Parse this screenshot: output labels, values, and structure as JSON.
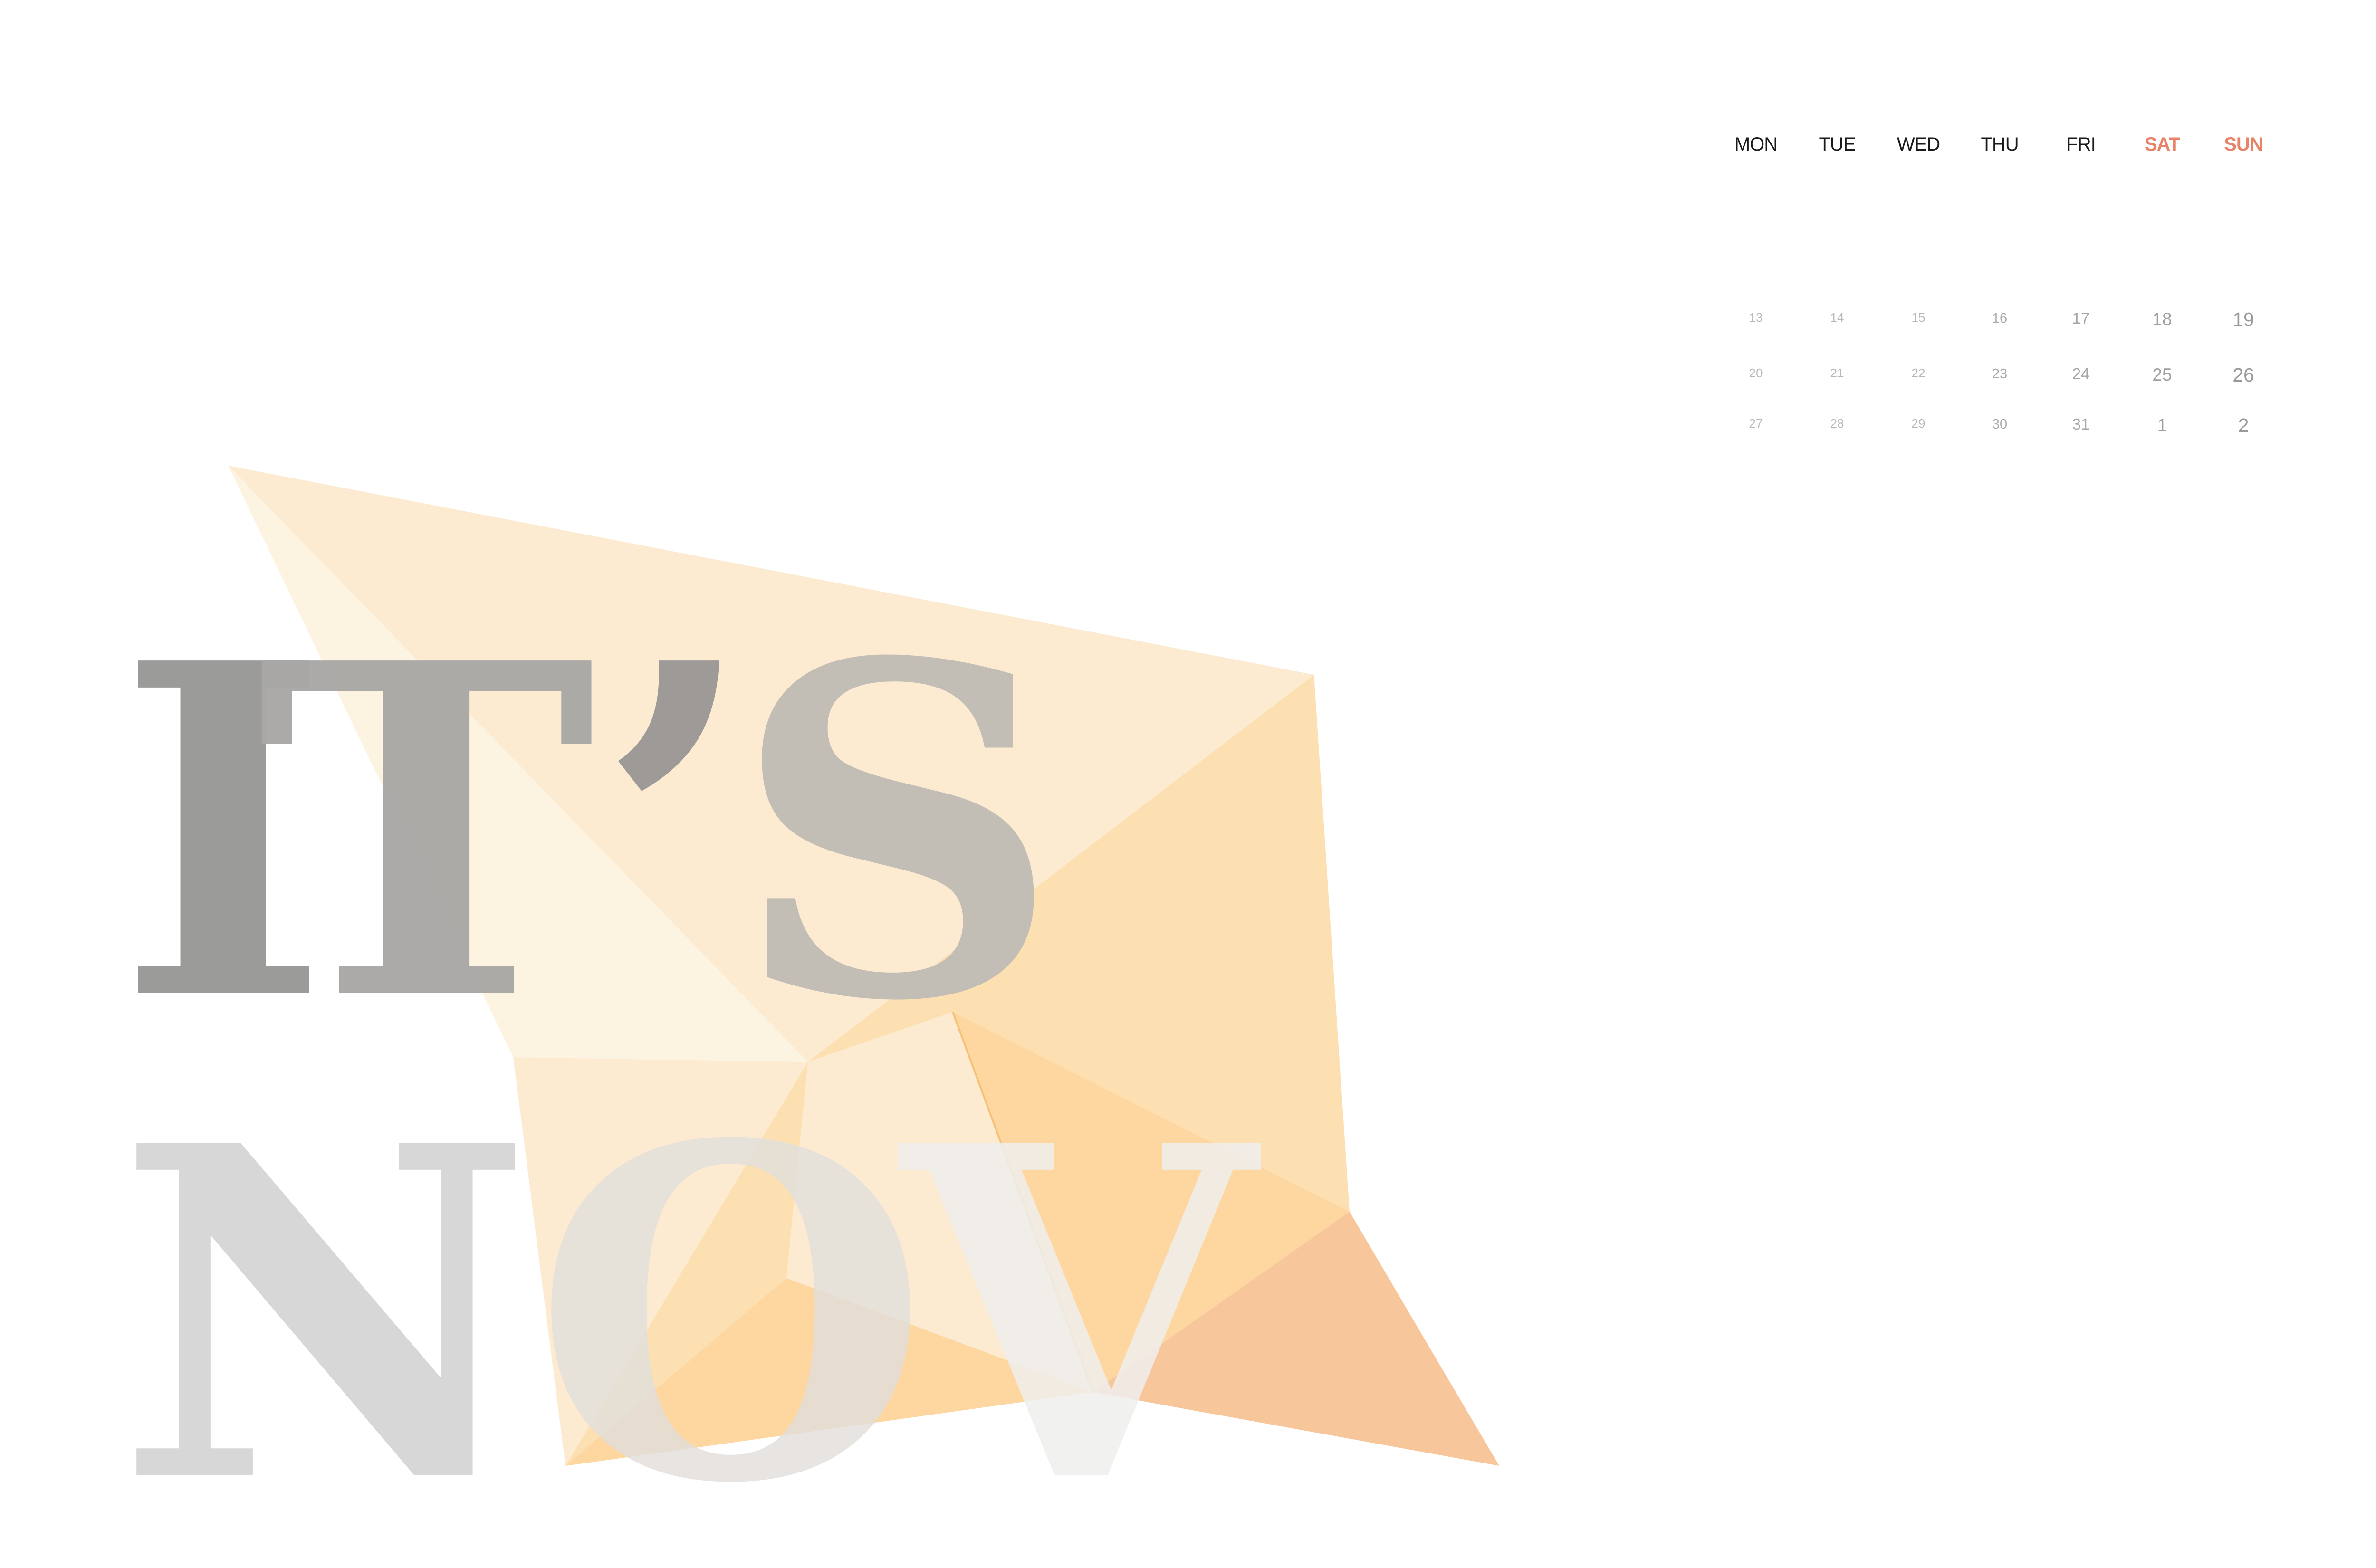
{
  "headline": {
    "line1": {
      "letters": [
        "I",
        "T",
        "’",
        "S"
      ]
    },
    "line2": {
      "letters": [
        "N",
        "O",
        "V"
      ]
    }
  },
  "calendar": {
    "weekdays": [
      "MON",
      "TUE",
      "WED",
      "THU",
      "FRI",
      "SAT",
      "SUN"
    ],
    "weeks": [
      [
        "13",
        "14",
        "15",
        "16",
        "17",
        "18",
        "19"
      ],
      [
        "20",
        "21",
        "22",
        "23",
        "24",
        "25",
        "26"
      ],
      [
        "27",
        "28",
        "29",
        "30",
        "31",
        "1",
        "2"
      ]
    ]
  },
  "colors": {
    "background": "#ffffff",
    "weekday": "#1a1a1a",
    "weekend_accent": "#e8836a",
    "weekday_numbers": "#b8b8b8",
    "weekend_numbers": "#9a9a9a",
    "letter_dark": "#9a9a98",
    "letter_mid": "#a9a8a6",
    "letter_s": "#c1bdb6",
    "letter_n": "#d6d6d6",
    "letter_o": "#e2dfdb",
    "letter_v": "#efefee",
    "shape_pale": "#fdf3e1",
    "shape_light": "#fdebd1",
    "shape_mid": "#fde0b2",
    "shape_deep": "#fdd6a0",
    "shape_peach": "#f8c69b"
  }
}
